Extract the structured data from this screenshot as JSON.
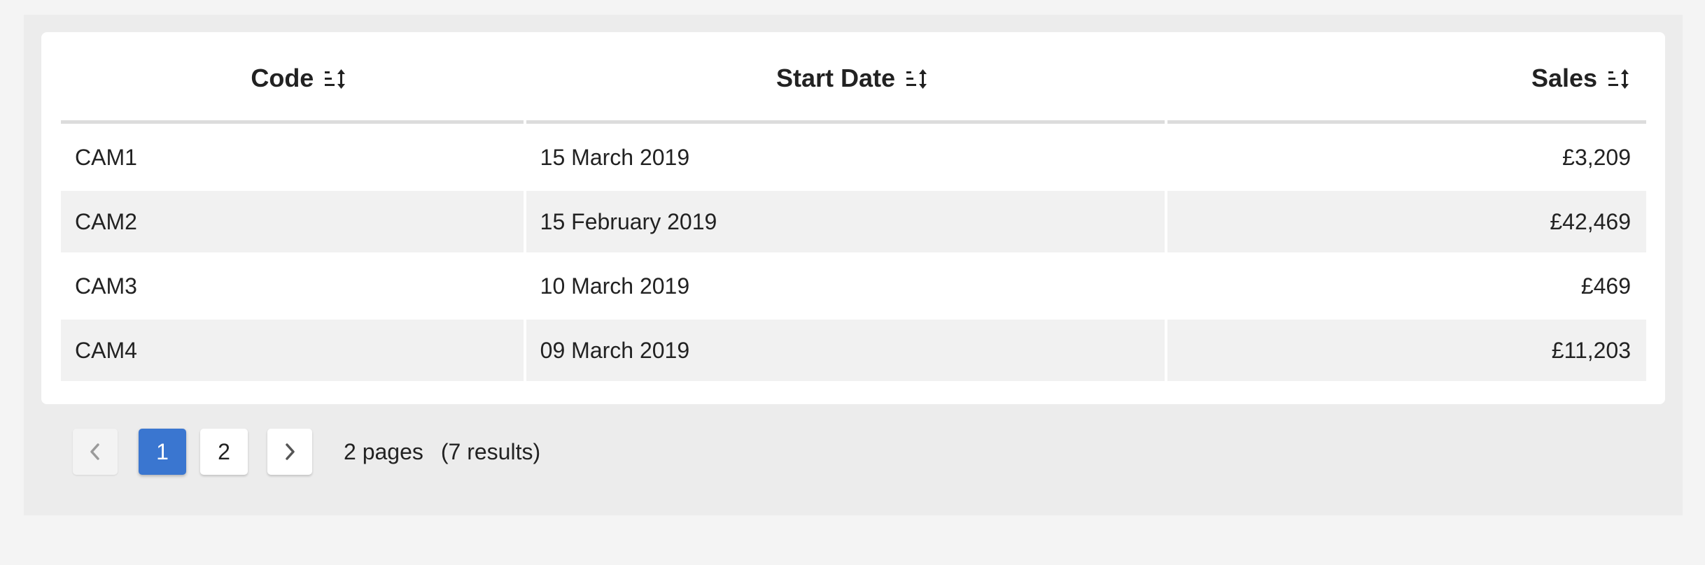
{
  "table": {
    "columns": [
      {
        "label": "Code"
      },
      {
        "label": "Start Date"
      },
      {
        "label": "Sales"
      }
    ],
    "rows": [
      {
        "code": "CAM1",
        "start_date": "15 March 2019",
        "sales": "£3,209"
      },
      {
        "code": "CAM2",
        "start_date": "15 February 2019",
        "sales": "£42,469"
      },
      {
        "code": "CAM3",
        "start_date": "10 March 2019",
        "sales": "£469"
      },
      {
        "code": "CAM4",
        "start_date": "09 March 2019",
        "sales": "£11,203"
      }
    ],
    "sort_icon": "sort-icon"
  },
  "pagination": {
    "prev_icon": "chevron-left-icon",
    "next_icon": "chevron-right-icon",
    "pages": [
      "1",
      "2"
    ],
    "current_page": "1",
    "pages_text": "2 pages",
    "results_text": "(7 results)",
    "accent_color": "#3a76d0"
  }
}
